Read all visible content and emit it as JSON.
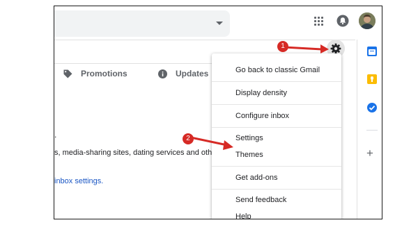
{
  "header": {
    "apps_icon": "apps-grid-icon",
    "notifications_icon": "bell-icon",
    "account_avatar": "avatar"
  },
  "tabs": [
    {
      "label": "Promotions",
      "icon": "tag-icon"
    },
    {
      "label": "Updates",
      "icon": "info-icon"
    }
  ],
  "main": {
    "partial_period": ".",
    "description": "s, media-sharing sites, dating services and other so",
    "link": "inbox settings."
  },
  "settings_menu": {
    "items": [
      "Go back to classic Gmail",
      "Display density",
      "Configure inbox",
      "Settings",
      "Themes",
      "Get add-ons",
      "Send feedback",
      "Help"
    ]
  },
  "annotations": [
    {
      "number": "1"
    },
    {
      "number": "2"
    }
  ],
  "side_panel": {
    "icons": [
      "calendar-icon",
      "keep-icon",
      "tasks-icon"
    ],
    "add_label": "+"
  },
  "colors": {
    "annotation_red": "#d62a25",
    "link_blue": "#1a56c4"
  }
}
